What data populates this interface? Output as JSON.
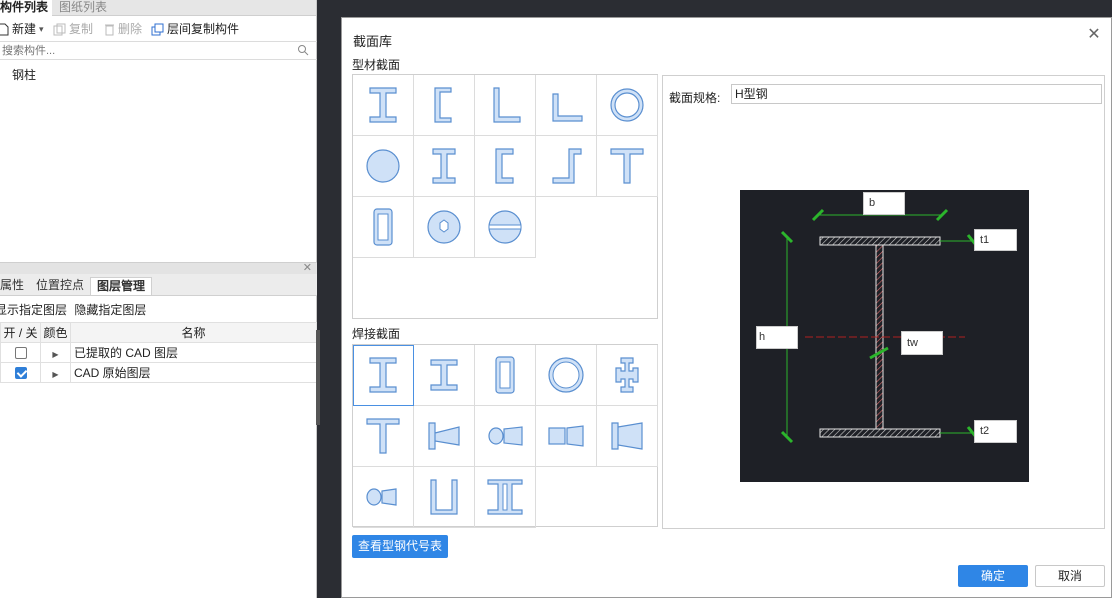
{
  "left_top_tabs": [
    "构件列表",
    "图纸列表"
  ],
  "toolbar": {
    "new": "新建",
    "copy": "复制",
    "delete": "删除",
    "layer_copy": "层间复制构件"
  },
  "search": {
    "placeholder": "搜索构件..."
  },
  "tree": {
    "items": [
      "钢柱"
    ]
  },
  "bottom_tabs": [
    "属性",
    "位置控点",
    "图层管理"
  ],
  "layer_actions": {
    "show": "显示指定图层",
    "hide": "隐藏指定图层"
  },
  "layer_table": {
    "headers": [
      "开 / 关",
      "颜色",
      "名称"
    ],
    "rows": [
      {
        "on": false,
        "name": "已提取的 CAD 图层"
      },
      {
        "on": true,
        "name": "CAD 原始图层"
      }
    ]
  },
  "dialog": {
    "title": "截面库",
    "section_profile": "型材截面",
    "section_welded": "焊接截面",
    "view_code_button": "查看型钢代号表",
    "spec_label": "截面规格:",
    "spec_value": "H型钢",
    "ok": "确定",
    "cancel": "取消"
  },
  "diagram_labels": {
    "b": "b",
    "t1": "t1",
    "h": "h",
    "tw": "tw",
    "t2": "t2"
  },
  "profile_shapes": [
    "I-beam",
    "channel-C",
    "angle-L",
    "unequal-angle",
    "round-tube",
    "solid-round",
    "I-beam-narrow",
    "channel-C-2",
    "Z-section",
    "T-section",
    "rect-tube",
    "hex-pipe",
    "split-round"
  ],
  "welded_shapes": [
    "welded-I",
    "welded-I-2",
    "welded-box",
    "welded-round-tube",
    "cross-section",
    "welded-T",
    "tapered-I",
    "tapered-round",
    "tapered-box",
    "tapered-rect",
    "tapered-round-2",
    "welded-U",
    "welded-double-I"
  ]
}
